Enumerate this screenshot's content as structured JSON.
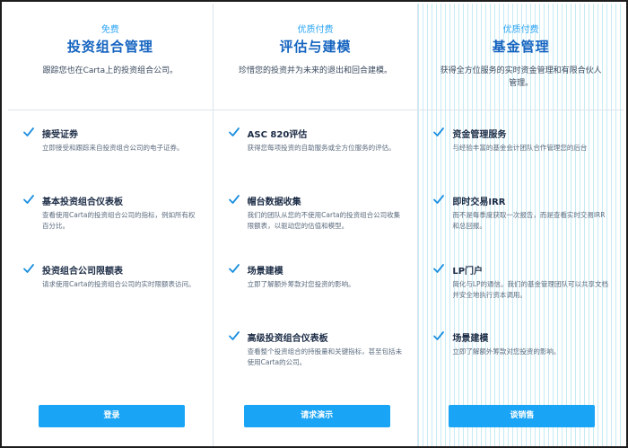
{
  "colors": {
    "accent": "#19a4f5",
    "title": "#1564c0",
    "check": "#1b8fe0"
  },
  "columns": [
    {
      "tier": "免费",
      "title": "投资组合管理",
      "description": "跟踪您也在Carta上的投资组合公司。",
      "features": [
        {
          "name": "接受证券",
          "desc": "立即接受和跟踪来自投资组合公司的电子证券。"
        },
        {
          "name": "基本投资组合仪表板",
          "desc": "查看使用Carta的投资组合公司的指标，例如所有权百分比。"
        },
        {
          "name": "投资组合公司限额表",
          "desc": "请求使用Carta的投资组合公司的实时限额表访问。"
        }
      ],
      "button": "登录"
    },
    {
      "tier": "优质付费",
      "title": "评估与建模",
      "description": "珍惜您的投资并为未来的退出和回合建模。",
      "features": [
        {
          "name": "ASC 820评估",
          "desc": "获得您每项投资的自助服务或全方位服务的评估。"
        },
        {
          "name": "帽台数据收集",
          "desc": "我们的团队从您的不使用Carta的投资组合公司收集限额表，以驱动您的估值和模型。"
        },
        {
          "name": "场景建模",
          "desc": "立即了解额外筹款对您投资的影响。"
        },
        {
          "name": "高级投资组合仪表板",
          "desc": "查看整个投资组合的持股量和关键指标，甚至包括未使用Carta的公司。"
        }
      ],
      "button": "请求演示"
    },
    {
      "tier": "优质付费",
      "title": "基金管理",
      "description": "获得全方位服务的实时资金管理和有限合伙人管理。",
      "features": [
        {
          "name": "资金管理服务",
          "desc": "与经验丰富的基金会计团队合作管理您的后台"
        },
        {
          "name": "即时交易IRR",
          "desc": "而不是每季度获取一次报告，而是查看实时交易IRR和总回报。"
        },
        {
          "name": "LP门户",
          "desc": "简化与LP的通信。我们的基金管理团队可以共享文档并安全地执行资本调用。"
        },
        {
          "name": "场景建模",
          "desc": "立即了解额外筹款对您投资的影响。"
        }
      ],
      "button": "谈销售"
    }
  ]
}
